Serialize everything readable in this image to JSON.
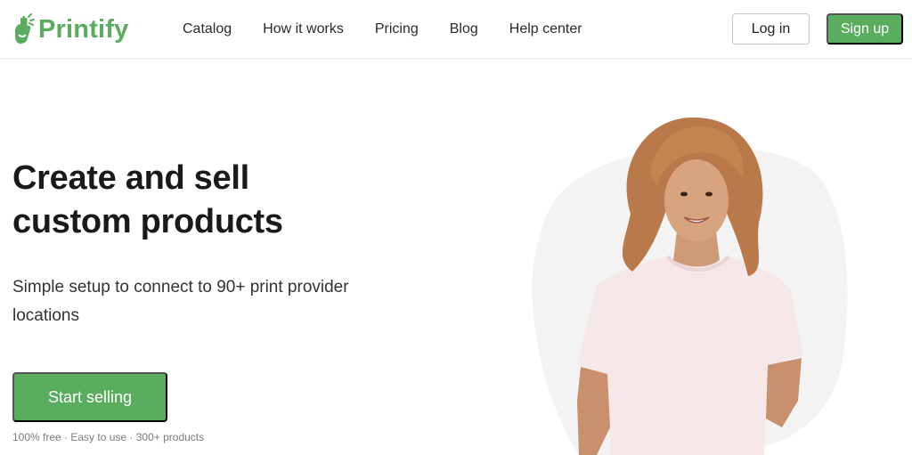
{
  "brand": {
    "name": "Printify",
    "accent": "#5aad5e",
    "logo_icon": "printify-hand-logo-icon"
  },
  "nav": {
    "items": [
      {
        "label": "Catalog"
      },
      {
        "label": "How it works"
      },
      {
        "label": "Pricing"
      },
      {
        "label": "Blog"
      },
      {
        "label": "Help center"
      }
    ]
  },
  "auth": {
    "login_label": "Log in",
    "signup_label": "Sign up"
  },
  "hero": {
    "title_line1": "Create and sell",
    "title_line2": "custom products",
    "subtitle": "Simple setup to connect to 90+ print provider locations",
    "cta_label": "Start selling",
    "note": "100% free · Easy to use · 300+ products",
    "image": "woman-in-pink-tshirt-photo"
  }
}
